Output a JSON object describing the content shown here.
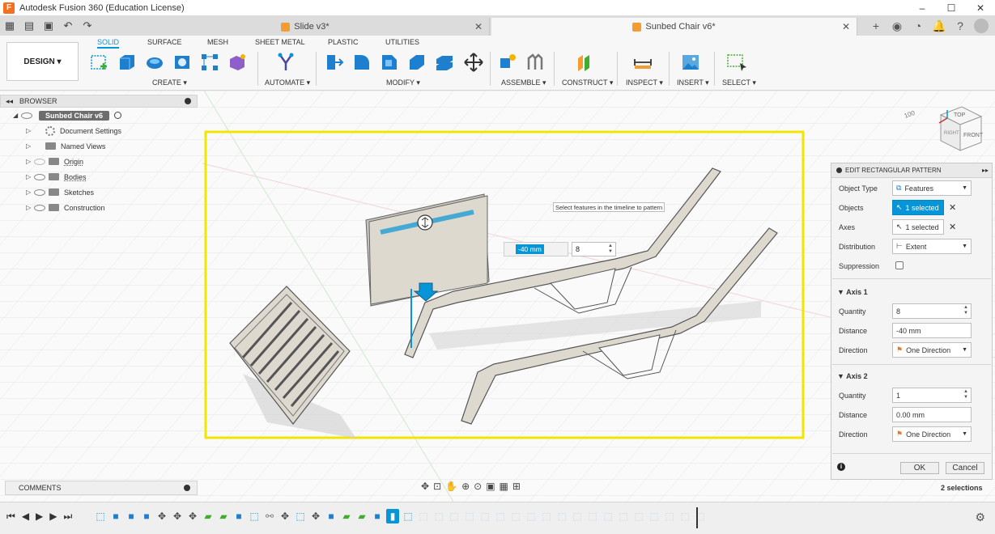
{
  "window": {
    "title": "Autodesk Fusion 360 (Education License)"
  },
  "tabs": [
    {
      "label": "Slide v3*",
      "active": false
    },
    {
      "label": "Sunbed Chair v6*",
      "active": true
    }
  ],
  "ribbon": {
    "design_label": "DESIGN ▾",
    "workspace_tabs": [
      "SOLID",
      "SURFACE",
      "MESH",
      "SHEET METAL",
      "PLASTIC",
      "UTILITIES"
    ],
    "groups": {
      "create": "CREATE ▾",
      "automate": "AUTOMATE ▾",
      "modify": "MODIFY ▾",
      "assemble": "ASSEMBLE ▾",
      "construct": "CONSTRUCT ▾",
      "inspect": "INSPECT ▾",
      "insert": "INSERT ▾",
      "select": "SELECT ▾"
    }
  },
  "browser": {
    "title": "BROWSER",
    "root": "Sunbed Chair v6",
    "items": [
      {
        "label": "Document Settings"
      },
      {
        "label": "Named Views"
      },
      {
        "label": "Origin"
      },
      {
        "label": "Bodies"
      },
      {
        "label": "Sketches"
      },
      {
        "label": "Construction"
      }
    ]
  },
  "viewport": {
    "tooltip": "Select features in the timeline to pattern",
    "distance_value": "-40 mm",
    "quantity_value": "8",
    "viewcube_top": "TOP",
    "viewcube_front": "FRONT",
    "viewcube_side": "RIGHT"
  },
  "edit_panel": {
    "title": "EDIT RECTANGULAR PATTERN",
    "object_type_label": "Object Type",
    "object_type_value": "Features",
    "objects_label": "Objects",
    "objects_value": "1 selected",
    "axes_label": "Axes",
    "axes_value": "1 selected",
    "distribution_label": "Distribution",
    "distribution_value": "Extent",
    "suppression_label": "Suppression",
    "axis1": {
      "title": "Axis 1",
      "quantity_label": "Quantity",
      "quantity_value": "8",
      "distance_label": "Distance",
      "distance_value": "-40 mm",
      "direction_label": "Direction",
      "direction_value": "One Direction"
    },
    "axis2": {
      "title": "Axis 2",
      "quantity_label": "Quantity",
      "quantity_value": "1",
      "distance_label": "Distance",
      "distance_value": "0.00 mm",
      "direction_label": "Direction",
      "direction_value": "One Direction"
    },
    "ok_label": "OK",
    "cancel_label": "Cancel"
  },
  "status": {
    "selections": "2 selections"
  },
  "comments": {
    "title": "COMMENTS"
  },
  "colors": {
    "accent": "#0696d7",
    "selection_frame": "#f2e600",
    "body_fill": "#ded9cf"
  }
}
